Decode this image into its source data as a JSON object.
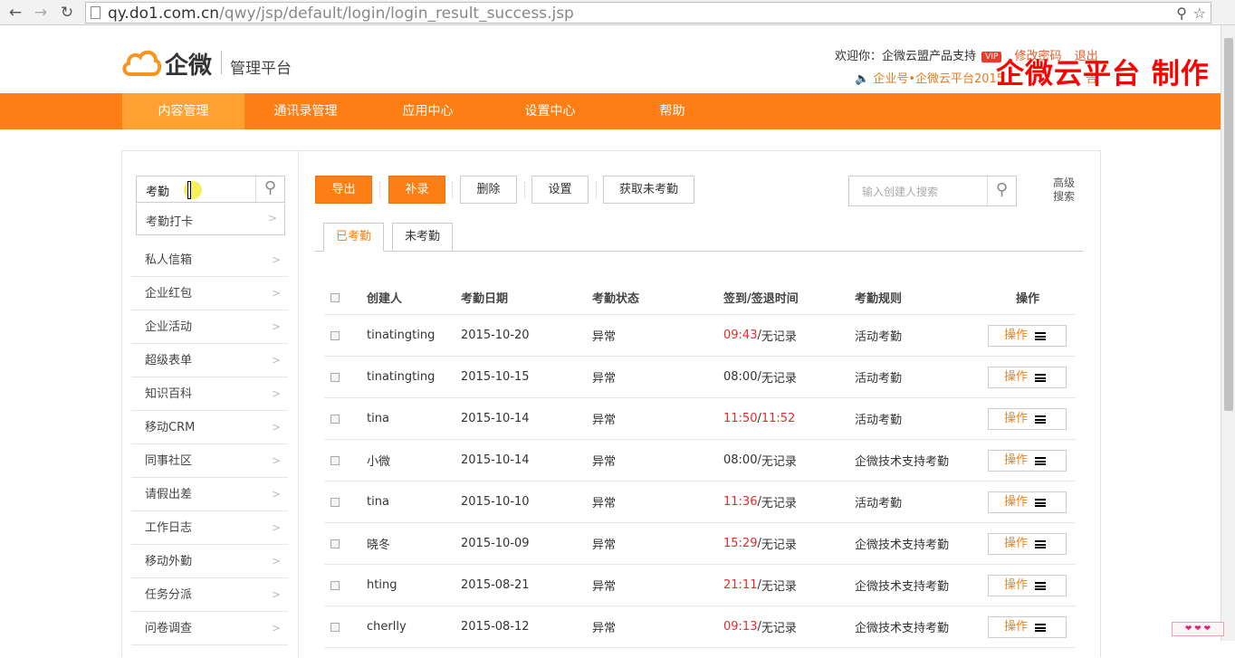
{
  "browser": {
    "url_host": "qy.do1.com.cn",
    "url_path": "/qwy/jsp/default/login/login_result_success.jsp"
  },
  "header": {
    "logo_text": "企微",
    "logo_sub": "管理平台",
    "welcome": "欢迎你：企微云盟产品支持",
    "vip": "VIP",
    "change_password": "修改密码",
    "logout": "退出",
    "notice": "企业号•企微云平台2015",
    "notice_tail": "告",
    "watermark": "企微云平台 制作"
  },
  "mainnav": {
    "items": [
      "内容管理",
      "通讯录管理",
      "应用中心",
      "设置中心",
      "帮助"
    ],
    "active": "内容管理"
  },
  "sidebar": {
    "search_value": "考勤",
    "suggestion": "考勤打卡",
    "items": [
      "私人信箱",
      "企业红包",
      "企业活动",
      "超级表单",
      "知识百科",
      "移动CRM",
      "同事社区",
      "请假出差",
      "工作日志",
      "移动外勤",
      "任务分派",
      "问卷调查"
    ]
  },
  "toolbar": {
    "export": "导出",
    "supplement": "补录",
    "delete": "删除",
    "settings": "设置",
    "fetch_absent": "获取未考勤",
    "search_placeholder": "输入创建人搜索",
    "advanced_search": "高级搜索"
  },
  "tabs": [
    "已考勤",
    "未考勤"
  ],
  "table": {
    "columns": [
      "创建人",
      "考勤日期",
      "考勤状态",
      "签到/签退时间",
      "考勤规则",
      "操作"
    ],
    "action_label": "操作",
    "rows": [
      {
        "creator": "tinatingting",
        "date": "2015-10-20",
        "status": "异常",
        "in": "09:43",
        "sep": "/",
        "out": "无记录",
        "in_red": true,
        "out_red": false,
        "rule": "活动考勤"
      },
      {
        "creator": "tinatingting",
        "date": "2015-10-15",
        "status": "异常",
        "in": "08:00",
        "sep": "/",
        "out": "无记录",
        "in_red": false,
        "out_red": false,
        "rule": "活动考勤"
      },
      {
        "creator": "tina",
        "date": "2015-10-14",
        "status": "异常",
        "in": "11:50",
        "sep": "/",
        "out": "11:52",
        "in_red": true,
        "out_red": true,
        "rule": "活动考勤"
      },
      {
        "creator": "小微",
        "date": "2015-10-14",
        "status": "异常",
        "in": "08:00",
        "sep": "/",
        "out": "无记录",
        "in_red": false,
        "out_red": false,
        "rule": "企微技术支持考勤"
      },
      {
        "creator": "tina",
        "date": "2015-10-10",
        "status": "异常",
        "in": "11:36",
        "sep": "/",
        "out": "无记录",
        "in_red": true,
        "out_red": false,
        "rule": "活动考勤"
      },
      {
        "creator": "晓冬",
        "date": "2015-10-09",
        "status": "异常",
        "in": "15:29",
        "sep": "/",
        "out": "无记录",
        "in_red": true,
        "out_red": false,
        "rule": "企微技术支持考勤"
      },
      {
        "creator": "hting",
        "date": "2015-08-21",
        "status": "异常",
        "in": "21:11",
        "sep": "/",
        "out": "无记录",
        "in_red": true,
        "out_red": false,
        "rule": "企微技术支持考勤"
      },
      {
        "creator": "cherlly",
        "date": "2015-08-12",
        "status": "异常",
        "in": "09:13",
        "sep": "/",
        "out": "无记录",
        "in_red": true,
        "out_red": false,
        "rule": "企微技术支持考勤"
      }
    ]
  },
  "colors": {
    "accent": "#fd7e14",
    "nav_active": "#ffa133",
    "red": "#e52b2b"
  }
}
